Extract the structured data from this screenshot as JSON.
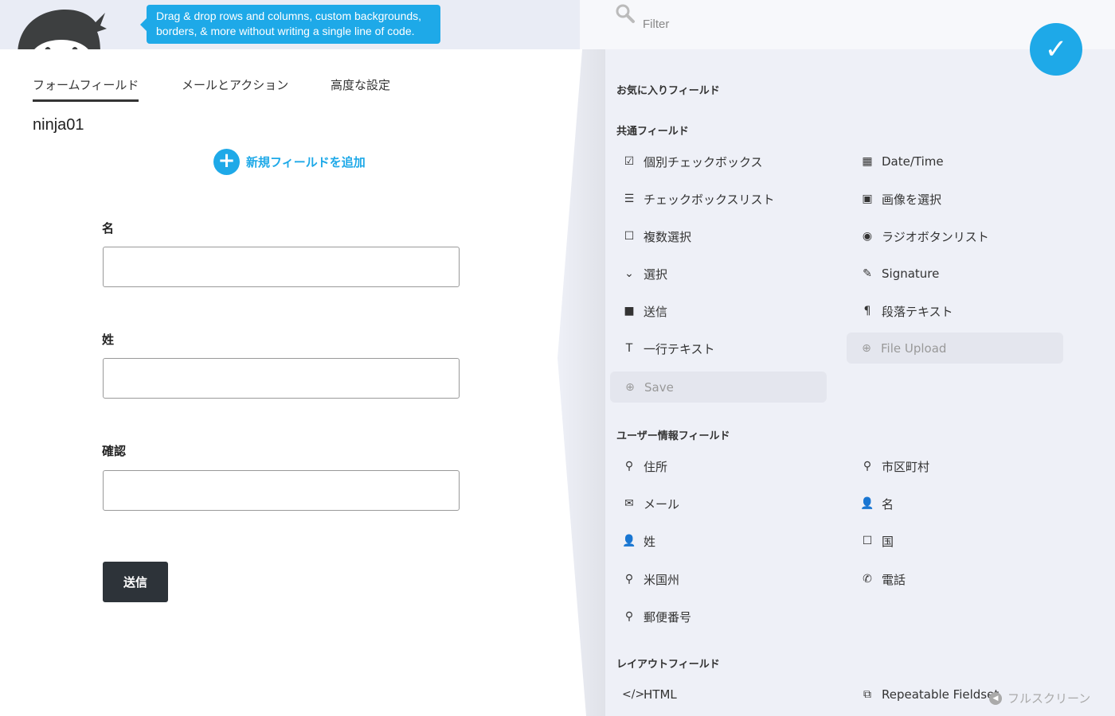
{
  "header": {
    "tooltip": "Drag & drop rows and columns, custom backgrounds, borders, & more without writing a single line of code."
  },
  "tabs": [
    {
      "label": "フォームフィールド",
      "active": true
    },
    {
      "label": "メールとアクション"
    },
    {
      "label": "高度な設定"
    }
  ],
  "form": {
    "title": "ninja01",
    "add_field": "新規フィールドを追加",
    "fields": [
      {
        "label": "名",
        "value": ""
      },
      {
        "label": "姓",
        "value": ""
      },
      {
        "label": "確認",
        "value": ""
      }
    ],
    "submit": "送信"
  },
  "panel": {
    "filter_placeholder": "Filter",
    "done_icon": "check-icon",
    "accent": "#1ea9e8",
    "favorites_title": "お気に入りフィールド",
    "common_title": "共通フィールド",
    "common": [
      {
        "label": "個別チェックボックス",
        "icon": "checkbox-icon",
        "glyph": "☑"
      },
      {
        "label": "Date/Time",
        "icon": "calendar-icon",
        "glyph": "▦"
      },
      {
        "label": "チェックボックスリスト",
        "icon": "list-icon",
        "glyph": "☰"
      },
      {
        "label": "画像を選択",
        "icon": "image-icon",
        "glyph": "▣"
      },
      {
        "label": "複数選択",
        "icon": "square-icon",
        "glyph": "☐"
      },
      {
        "label": "ラジオボタンリスト",
        "icon": "radio-icon",
        "glyph": "◉"
      },
      {
        "label": "選択",
        "icon": "chevron-down-icon",
        "glyph": "⌄"
      },
      {
        "label": "Signature",
        "icon": "edit-icon",
        "glyph": "✎"
      },
      {
        "label": "送信",
        "icon": "square-filled-icon",
        "glyph": "■"
      },
      {
        "label": "段落テキスト",
        "icon": "paragraph-icon",
        "glyph": "¶"
      },
      {
        "label": "一行テキスト",
        "icon": "text-icon",
        "glyph": "T"
      },
      {
        "label": "File Upload",
        "icon": "upload-icon",
        "glyph": "⊕",
        "disabled": true
      },
      {
        "label": "Save",
        "icon": "save-icon",
        "glyph": "⊕",
        "disabled": true
      }
    ],
    "user_title": "ユーザー情報フィールド",
    "user": [
      {
        "label": "住所",
        "icon": "map-marker-icon",
        "glyph": "⚲"
      },
      {
        "label": "市区町村",
        "icon": "map-marker-icon",
        "glyph": "⚲"
      },
      {
        "label": "メール",
        "icon": "envelope-icon",
        "glyph": "✉"
      },
      {
        "label": "名",
        "icon": "user-icon",
        "glyph": "👤"
      },
      {
        "label": "姓",
        "icon": "user-icon",
        "glyph": "👤"
      },
      {
        "label": "国",
        "icon": "square-icon",
        "glyph": "☐"
      },
      {
        "label": "米国州",
        "icon": "map-marker-icon",
        "glyph": "⚲"
      },
      {
        "label": "電話",
        "icon": "phone-icon",
        "glyph": "✆"
      },
      {
        "label": "郵便番号",
        "icon": "map-marker-icon",
        "glyph": "⚲"
      }
    ],
    "layout_title": "レイアウトフィールド",
    "layout": [
      {
        "label": "HTML",
        "icon": "code-icon",
        "glyph": "</>"
      },
      {
        "label": "Repeatable Fieldset",
        "icon": "copy-icon",
        "glyph": "⧉"
      }
    ],
    "fullscreen": "フルスクリーン"
  }
}
